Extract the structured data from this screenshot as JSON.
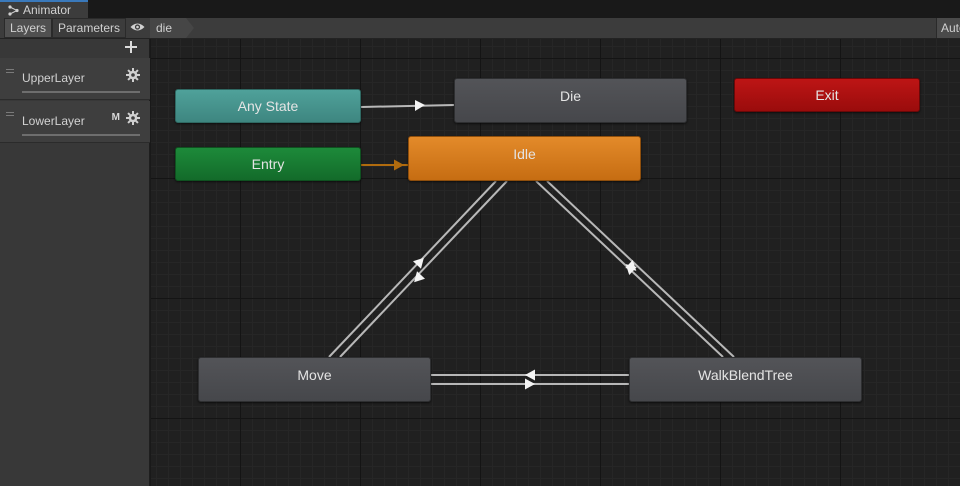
{
  "window": {
    "tab_title": "Animator",
    "tab_icon": "animator-graph-icon"
  },
  "toolbar": {
    "layers_label": "Layers",
    "parameters_label": "Parameters",
    "eye_icon": "eye-icon",
    "breadcrumb": "die",
    "auto_label": "Auto"
  },
  "layers": {
    "add_icon": "plus-icon",
    "items": [
      {
        "name": "UpperLayer",
        "badge": ""
      },
      {
        "name": "LowerLayer",
        "badge": "M"
      }
    ]
  },
  "states": {
    "any_state": "Any State",
    "entry": "Entry",
    "die": "Die",
    "idle": "Idle",
    "exit": "Exit",
    "move": "Move",
    "walk_blend_tree": "WalkBlendTree"
  },
  "colors": {
    "any_state": "#4fa19a",
    "entry": "#1d8a3a",
    "default_state": "#e38a2a",
    "exit": "#bd1515",
    "state": "#535458",
    "transition": "#b8b8b8",
    "entry_transition": "#b06b0e"
  }
}
